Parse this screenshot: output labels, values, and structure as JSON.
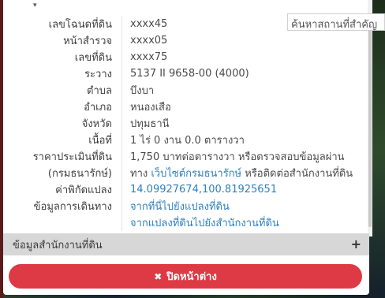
{
  "search": {
    "placeholder": "ค้นหาสถานที่สำคัญ"
  },
  "info_rows": [
    {
      "label": "เลขโฉนดที่ดิน",
      "value": "xxxx45"
    },
    {
      "label": "หน้าสำรวจ",
      "value": "xxxx05"
    },
    {
      "label": "เลขที่ดิน",
      "value": "xxxx75"
    },
    {
      "label": "ระวาง",
      "value": "5137 II 9658-00 (4000)"
    },
    {
      "label": "ตำบล",
      "value": "บึงบา"
    },
    {
      "label": "อำเภอ",
      "value": "หนองเสือ"
    },
    {
      "label": "จังหวัด",
      "value": "ปทุมธานี"
    },
    {
      "label": "เนื้อที่",
      "value": "1 ไร่ 0 งาน 0.0 ตารางวา"
    }
  ],
  "price": {
    "label_line1": "ราคาประเมินที่ดิน",
    "label_line2": "(กรมธนารักษ์)",
    "value_line1": "1,750 บาทต่อตารางวา หรือตรวจสอบข้อมูลผ่าน",
    "value_line2_prefix": "ทาง ",
    "value_line2_link": "เว็บไซต์กรมธนารักษ์",
    "value_line2_suffix": " หรือติดต่อสำนักงานที่ดิน"
  },
  "coords": {
    "label": "ค่าพิกัดแปลง",
    "value": "14.09927674,100.81925651"
  },
  "travel": {
    "label": "ข้อมูลการเดินทาง",
    "link1": "จากที่นี่ไปยังแปลงที่ดิน",
    "link2": "จากแปลงที่ดินไปยังสำนักงานที่ดิน"
  },
  "accordion": {
    "label": "ข้อมูลสำนักงานที่ดิน",
    "icon": "plus-icon"
  },
  "close_button": {
    "label": "ปิดหน้าต่าง",
    "icon": "close-icon"
  },
  "colors": {
    "link": "#2f7fc0",
    "close_button": "#dd3a46",
    "accordion_bg": "#d7d7d7"
  }
}
